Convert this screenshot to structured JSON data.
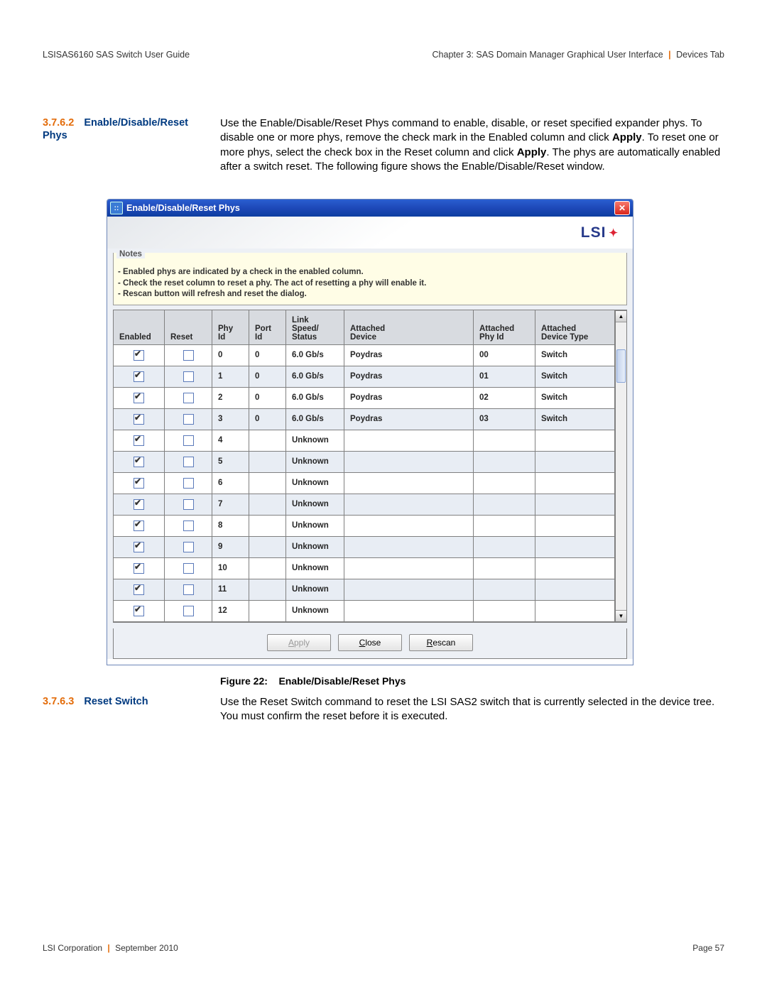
{
  "header": {
    "left": "LSISAS6160 SAS Switch User Guide",
    "chapter": "Chapter 3: SAS Domain Manager Graphical User Interface",
    "section": "Devices Tab"
  },
  "section_3762": {
    "num": "3.7.6.2",
    "title": "Enable/Disable/Reset Phys",
    "body_a": "Use the Enable/Disable/Reset Phys command to enable, disable, or reset specified expander phys. To disable one or more phys, remove the check mark in the Enabled column and click ",
    "apply1": "Apply",
    "body_b": ". To reset one or more phys, select the check box in the Reset column and click ",
    "apply2": "Apply",
    "body_c": ". The phys are automatically enabled after a switch reset. The following figure shows the Enable/Disable/Reset window."
  },
  "window": {
    "title": "Enable/Disable/Reset Phys",
    "banner": "LSI",
    "notes_legend": "Notes",
    "notes": [
      "- Enabled phys are indicated by a check in the enabled column.",
      "- Check the reset column to reset a phy. The act of resetting a phy will enable it.",
      "- Rescan button will refresh and reset the dialog."
    ],
    "columns": [
      "Enabled",
      "Reset",
      "Phy Id",
      "Port Id",
      "Link Speed/ Status",
      "Attached Device",
      "Attached Phy Id",
      "Attached Device Type"
    ],
    "rows": [
      {
        "enabled": true,
        "reset": false,
        "phy": "0",
        "port": "0",
        "link": "6.0 Gb/s",
        "dev": "Poydras",
        "aphy": "00",
        "atype": "Switch",
        "hot": true
      },
      {
        "enabled": true,
        "reset": false,
        "phy": "1",
        "port": "0",
        "link": "6.0 Gb/s",
        "dev": "Poydras",
        "aphy": "01",
        "atype": "Switch",
        "hot": true
      },
      {
        "enabled": true,
        "reset": false,
        "phy": "2",
        "port": "0",
        "link": "6.0 Gb/s",
        "dev": "Poydras",
        "aphy": "02",
        "atype": "Switch",
        "hot": true
      },
      {
        "enabled": true,
        "reset": false,
        "phy": "3",
        "port": "0",
        "link": "6.0 Gb/s",
        "dev": "Poydras",
        "aphy": "03",
        "atype": "Switch",
        "hot": true
      },
      {
        "enabled": true,
        "reset": false,
        "phy": "4",
        "port": "",
        "link": "Unknown",
        "dev": "",
        "aphy": "",
        "atype": "",
        "hot": false
      },
      {
        "enabled": true,
        "reset": false,
        "phy": "5",
        "port": "",
        "link": "Unknown",
        "dev": "",
        "aphy": "",
        "atype": "",
        "hot": false
      },
      {
        "enabled": true,
        "reset": false,
        "phy": "6",
        "port": "",
        "link": "Unknown",
        "dev": "",
        "aphy": "",
        "atype": "",
        "hot": false
      },
      {
        "enabled": true,
        "reset": false,
        "phy": "7",
        "port": "",
        "link": "Unknown",
        "dev": "",
        "aphy": "",
        "atype": "",
        "hot": false
      },
      {
        "enabled": true,
        "reset": false,
        "phy": "8",
        "port": "",
        "link": "Unknown",
        "dev": "",
        "aphy": "",
        "atype": "",
        "hot": false
      },
      {
        "enabled": true,
        "reset": false,
        "phy": "9",
        "port": "",
        "link": "Unknown",
        "dev": "",
        "aphy": "",
        "atype": "",
        "hot": false
      },
      {
        "enabled": true,
        "reset": false,
        "phy": "10",
        "port": "",
        "link": "Unknown",
        "dev": "",
        "aphy": "",
        "atype": "",
        "hot": false
      },
      {
        "enabled": true,
        "reset": false,
        "phy": "11",
        "port": "",
        "link": "Unknown",
        "dev": "",
        "aphy": "",
        "atype": "",
        "hot": false
      },
      {
        "enabled": true,
        "reset": false,
        "phy": "12",
        "port": "",
        "link": "Unknown",
        "dev": "",
        "aphy": "",
        "atype": "",
        "hot": false
      }
    ],
    "buttons": {
      "apply": "Apply",
      "close": "Close",
      "rescan": "Rescan"
    }
  },
  "figure": {
    "label": "Figure 22:",
    "title": "Enable/Disable/Reset Phys"
  },
  "section_3763": {
    "num": "3.7.6.3",
    "title": "Reset Switch",
    "body": "Use the Reset Switch command to reset the LSI SAS2 switch that is currently selected in the device tree. You must confirm the reset before it is executed."
  },
  "footer": {
    "corp": "LSI Corporation",
    "date": "September 2010",
    "page": "Page 57"
  }
}
